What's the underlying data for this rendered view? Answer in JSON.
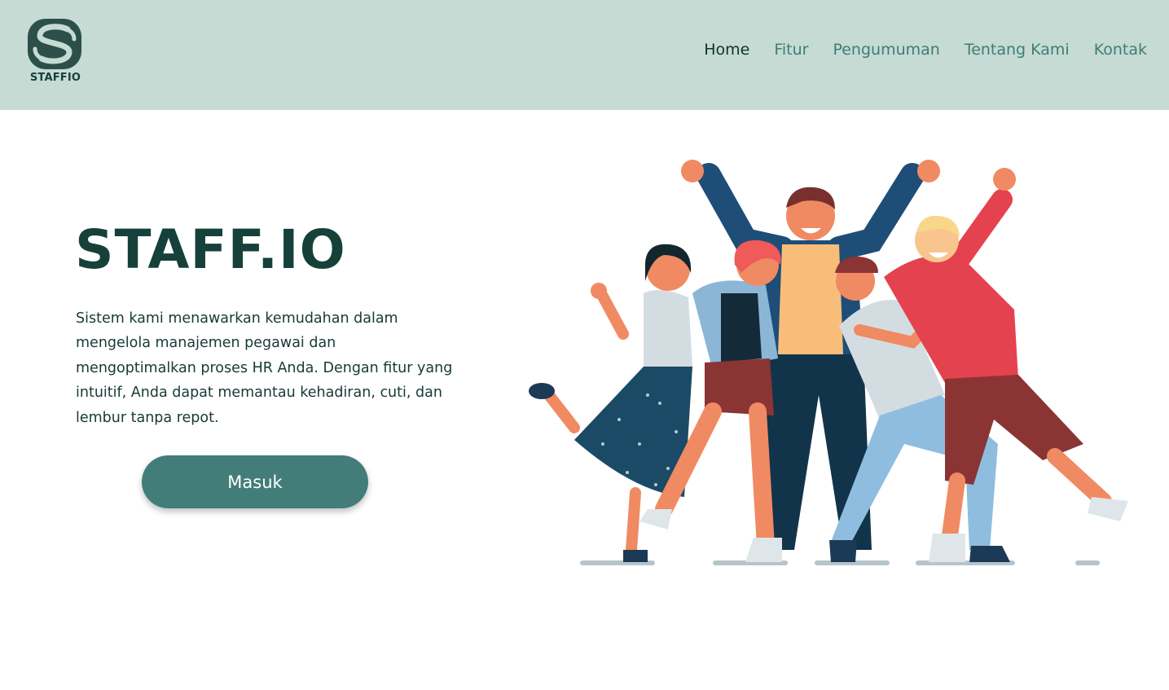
{
  "brand": {
    "logo_text": "STAFFIO",
    "logo_icon": "staffio-s-logo-icon"
  },
  "nav": {
    "items": [
      {
        "label": "Home",
        "active": true
      },
      {
        "label": "Fitur",
        "active": false
      },
      {
        "label": "Pengumuman",
        "active": false
      },
      {
        "label": "Tentang Kami",
        "active": false
      },
      {
        "label": "Kontak",
        "active": false
      }
    ]
  },
  "hero": {
    "title": "STAFF.IO",
    "description": "Sistem kami menawarkan kemudahan dalam mengelola manajemen pegawai dan mengoptimalkan proses HR Anda. Dengan fitur yang intuitif, Anda dapat memantau kehadiran, cuti, dan lembur tanpa repot.",
    "cta_label": "Masuk",
    "illustration": "happy-team-illustration"
  },
  "colors": {
    "header_bg": "#c5dbd4",
    "brand_dark": "#16413a",
    "nav_link": "#3f7d76",
    "button_bg": "#437d79"
  }
}
